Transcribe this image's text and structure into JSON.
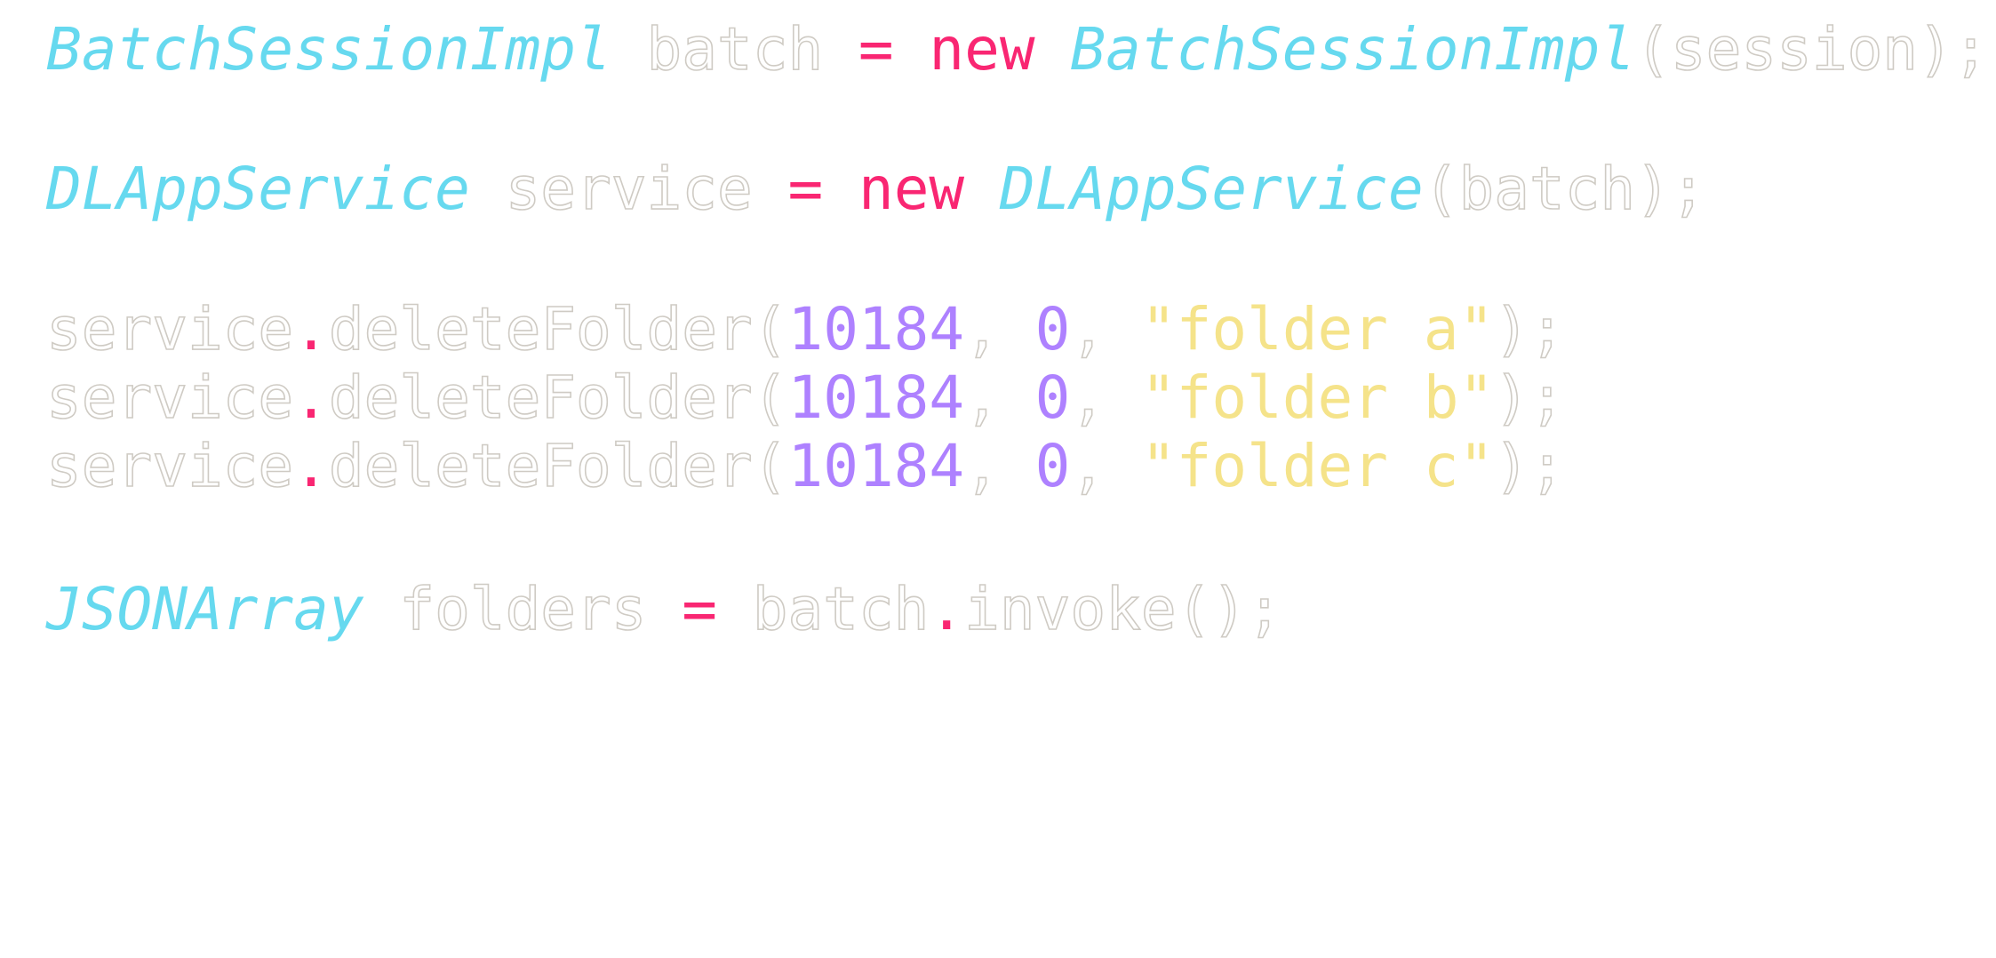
{
  "editor": {
    "colors": {
      "background": "#ffffff",
      "type": "#66d9ef",
      "keyword": "#f92672",
      "number": "#ae81ff",
      "string": "#f5e38a",
      "plain_outline": "#cfcbc4"
    },
    "lines": [
      {
        "t1": "BatchSessionImpl",
        "p1": " batch ",
        "op": "=",
        "sp": " ",
        "kw": "new",
        "sp2": " ",
        "t2": "BatchSessionImpl",
        "p2": "(session);"
      },
      {
        "t1": "DLAppService",
        "p1": " service ",
        "op": "=",
        "sp": " ",
        "kw": "new",
        "sp2": " ",
        "t2": "DLAppService",
        "p2": "(batch);"
      },
      {
        "p1": "service",
        "dot": ".",
        "p2": "deleteFolder(",
        "n1": "10184",
        "c1": ", ",
        "n2": "0",
        "c2": ", ",
        "s": "\"folder a\"",
        "end": ");"
      },
      {
        "p1": "service",
        "dot": ".",
        "p2": "deleteFolder(",
        "n1": "10184",
        "c1": ", ",
        "n2": "0",
        "c2": ", ",
        "s": "\"folder b\"",
        "end": ");"
      },
      {
        "p1": "service",
        "dot": ".",
        "p2": "deleteFolder(",
        "n1": "10184",
        "c1": ", ",
        "n2": "0",
        "c2": ", ",
        "s": "\"folder c\"",
        "end": ");"
      },
      {
        "t1": "JSONArray",
        "p1": " folders ",
        "op": "=",
        "p2": " batch",
        "dot": ".",
        "p3": "invoke();"
      }
    ]
  }
}
